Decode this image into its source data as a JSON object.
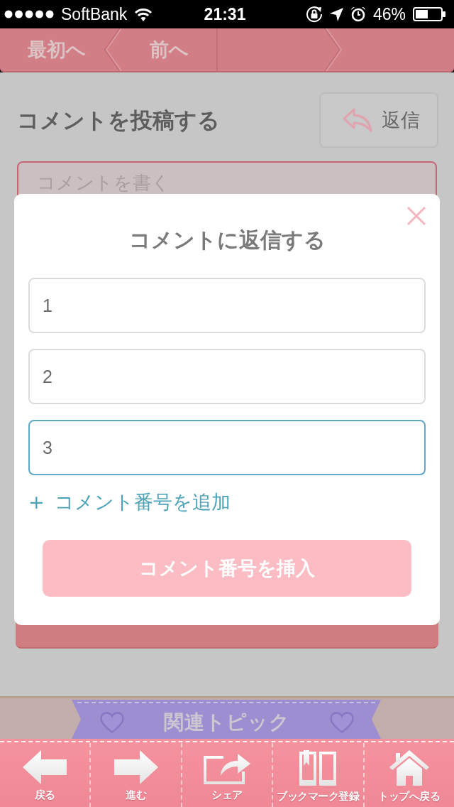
{
  "status_bar": {
    "carrier": "SoftBank",
    "time": "21:31",
    "battery": "46%"
  },
  "pagination": [
    {
      "label": "最初へ",
      "kind": "first"
    },
    {
      "label": "前へ",
      "kind": "prev"
    }
  ],
  "comment_form": {
    "title": "コメントを投稿する",
    "reply_button": "返信",
    "comment_field": {
      "placeholder": "コメントを書く"
    }
  },
  "reply_dialog": {
    "title": "コメントに返信する",
    "fields": [
      {
        "value": "1",
        "focused": false
      },
      {
        "value": "2",
        "focused": false
      },
      {
        "value": "3",
        "focused": true
      }
    ],
    "add_link": "+ コメント番号を追加",
    "insert_button": "コメント番号を挿入"
  },
  "related": {
    "title": "関連トピック"
  },
  "tab_bar": [
    {
      "label": "戻る",
      "kind": "back"
    },
    {
      "label": "進む",
      "kind": "forward"
    },
    {
      "label": "シェア",
      "kind": "share"
    },
    {
      "label": "ブックマーク登録",
      "kind": "bookmark"
    },
    {
      "label": "トップへ戻る",
      "kind": "home"
    }
  ]
}
